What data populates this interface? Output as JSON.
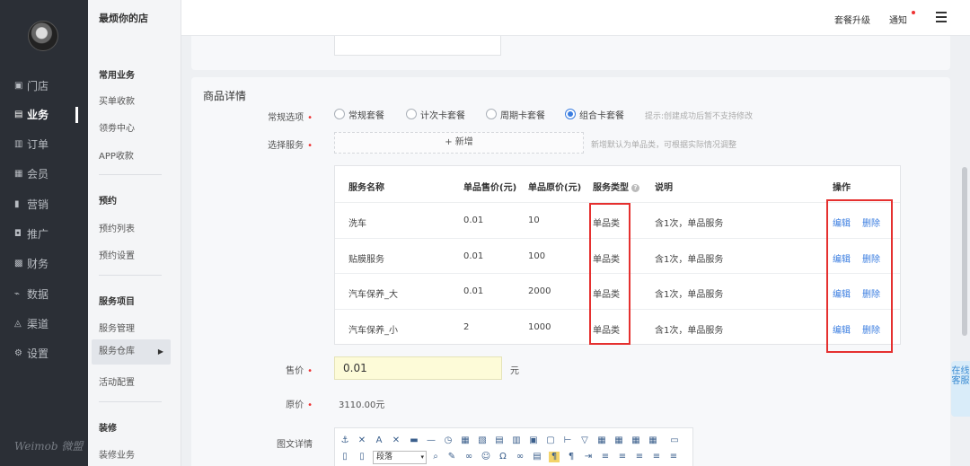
{
  "leftnav": {
    "items": [
      {
        "icon": "▣",
        "label": "门店"
      },
      {
        "icon": "▤",
        "label": "业务"
      },
      {
        "icon": "▥",
        "label": "订单"
      },
      {
        "icon": "▦",
        "label": "会员"
      },
      {
        "icon": "▮",
        "label": "营销"
      },
      {
        "icon": "◘",
        "label": "推广"
      },
      {
        "icon": "▩",
        "label": "财务"
      },
      {
        "icon": "⌁",
        "label": "数据"
      },
      {
        "icon": "◬",
        "label": "渠道"
      },
      {
        "icon": "⚙",
        "label": "设置"
      }
    ],
    "logo": "Weimob 微盟"
  },
  "subnav": {
    "shop_name": "最烦你的店",
    "group1_title": "常用业务",
    "group1_items": [
      "买单收款",
      "领劵中心",
      "APP收款"
    ],
    "group2_title": "预约",
    "group2_items": [
      "预约列表",
      "预约设置"
    ],
    "group3_title": "服务项目",
    "group3_items": [
      "服务管理",
      "服务仓库",
      "活动配置"
    ],
    "group4_title": "装修",
    "group4_items": [
      "装修业务"
    ]
  },
  "topbar": {
    "upgrade": "套餐升级",
    "notice": "通知"
  },
  "form": {
    "section_title": "商品详情",
    "option_label": "常规选项",
    "service_label": "选择服务",
    "price_label": "售价",
    "orig_label": "原价",
    "detail_label": "图文详情",
    "radios": [
      "常规套餐",
      "计次卡套餐",
      "周期卡套餐",
      "组合卡套餐"
    ],
    "radio_hint": "提示:创建成功后暂不支持修改",
    "add_label": "+ 新增",
    "add_hint": "新增默认为单品类，可根据实际情况调整",
    "price_value": "0.01",
    "price_unit": "元",
    "orig_value": "3110.00元",
    "editor_para": "段落"
  },
  "table": {
    "headers": [
      "服务名称",
      "单品售价(元)",
      "单品原价(元)",
      "服务类型",
      "说明",
      "操作"
    ],
    "rows": [
      {
        "name": "洗车",
        "price": "0.01",
        "orig": "10",
        "type": "单品类",
        "desc": "含1次，单品服务",
        "edit": "编辑",
        "del": "删除"
      },
      {
        "name": "贴膜服务",
        "price": "0.01",
        "orig": "100",
        "type": "单品类",
        "desc": "含1次，单品服务",
        "edit": "编辑",
        "del": "删除"
      },
      {
        "name": "汽车保养_大",
        "price": "0.01",
        "orig": "2000",
        "type": "单品类",
        "desc": "含1次，单品服务",
        "edit": "编辑",
        "del": "删除"
      },
      {
        "name": "汽车保养_小",
        "price": "2",
        "orig": "1000",
        "type": "单品类",
        "desc": "含1次，单品服务",
        "edit": "编辑",
        "del": "删除"
      }
    ]
  },
  "side_tab": "在线客服",
  "colors": {
    "accent": "#3a7de0",
    "highlight": "#e5302f",
    "nav_bg": "#2b2f36"
  }
}
